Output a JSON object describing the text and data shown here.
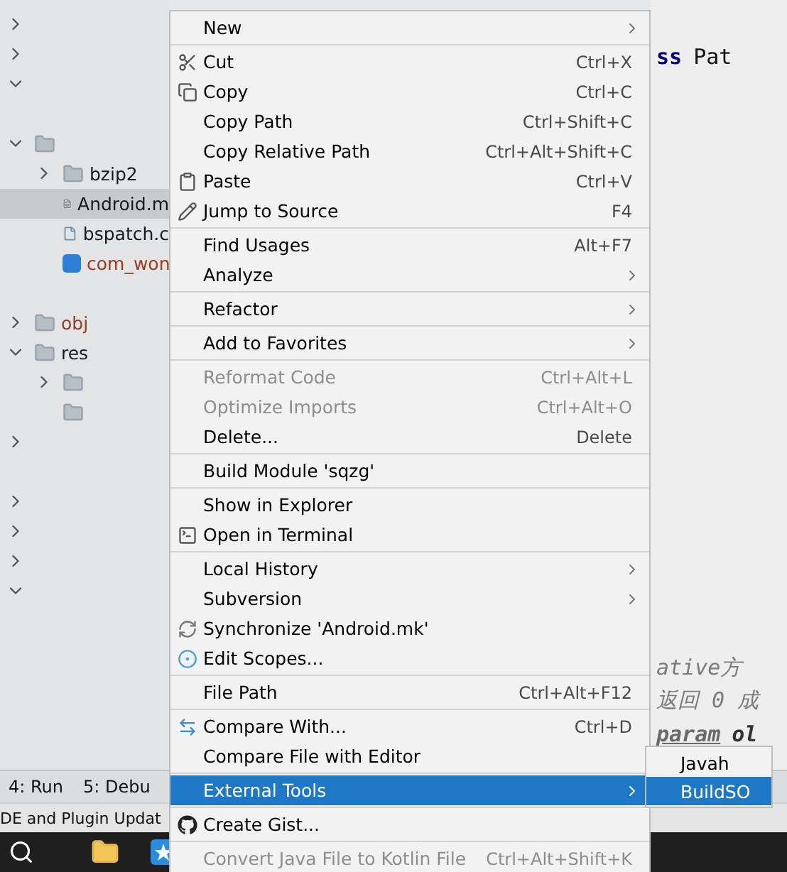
{
  "project_tree": {
    "rows": [
      {
        "kind": "blank",
        "expanded": false
      },
      {
        "kind": "blank",
        "expanded": false
      },
      {
        "kind": "blank",
        "expanded": true
      },
      {
        "kind": "blank"
      },
      {
        "kind": "folder",
        "expanded": true,
        "children": [
          {
            "kind": "folder",
            "expanded": false,
            "label": "bzip2"
          },
          {
            "kind": "file",
            "label": "Android.m",
            "selected": true
          },
          {
            "kind": "cfile",
            "label": "bspatch.c",
            "selected": false
          },
          {
            "kind": "header",
            "label": "com_won",
            "selected": false
          },
          {
            "kind": "blank"
          }
        ]
      },
      {
        "kind": "folder",
        "expanded": false,
        "label": "obj",
        "excluded": true
      },
      {
        "kind": "folder",
        "expanded": true,
        "label": "res",
        "excluded": false,
        "children": [
          {
            "kind": "folder",
            "expanded": false
          },
          {
            "kind": "folder"
          }
        ]
      },
      {
        "kind": "blank",
        "expanded": false
      },
      {
        "kind": "blank"
      },
      {
        "kind": "blank",
        "expanded": false
      },
      {
        "kind": "blank",
        "expanded": false
      },
      {
        "kind": "blank",
        "expanded": false
      },
      {
        "kind": "blank",
        "expanded": true
      }
    ]
  },
  "editor": {
    "top_line": {
      "keyword": "ss",
      "text": "Pat"
    },
    "bottom_lines": [
      {
        "kind": "comment",
        "text": "ative方"
      },
      {
        "kind": "comment",
        "text": "返回 0 成"
      },
      {
        "kind": "doc_tag",
        "tag": "param",
        "text": "ol"
      }
    ]
  },
  "tool_window_bar": [
    "4: Run",
    "5: Debu"
  ],
  "status_bar": "DE and Plugin Updat",
  "context_menu": {
    "groups": [
      {
        "items": [
          {
            "label": "New",
            "submenu": true
          }
        ]
      },
      {
        "items": [
          {
            "label": "Cut",
            "shortcut": "Ctrl+X"
          },
          {
            "label": "Copy",
            "shortcut": "Ctrl+C"
          },
          {
            "label": "Copy Path",
            "shortcut": "Ctrl+Shift+C"
          },
          {
            "label": "Copy Relative Path",
            "shortcut": "Ctrl+Alt+Shift+C"
          },
          {
            "label": "Paste",
            "shortcut": "Ctrl+V"
          },
          {
            "label": "Jump to Source",
            "shortcut": "F4"
          }
        ]
      },
      {
        "items": [
          {
            "label": "Find Usages",
            "shortcut": "Alt+F7"
          },
          {
            "label": "Analyze",
            "submenu": true
          }
        ]
      },
      {
        "items": [
          {
            "label": "Refactor",
            "submenu": true
          }
        ]
      },
      {
        "items": [
          {
            "label": "Add to Favorites",
            "submenu": true
          }
        ]
      },
      {
        "items": [
          {
            "label": "Reformat Code",
            "shortcut": "Ctrl+Alt+L",
            "disabled": true
          },
          {
            "label": "Optimize Imports",
            "shortcut": "Ctrl+Alt+O",
            "disabled": true
          },
          {
            "label": "Delete...",
            "shortcut": "Delete",
            "disabled": false
          }
        ]
      },
      {
        "items": [
          {
            "label": "Build Module 'sqzg'"
          }
        ]
      },
      {
        "items": [
          {
            "label": "Show in Explorer"
          },
          {
            "label": "Open in Terminal"
          }
        ]
      },
      {
        "items": [
          {
            "label": "Local History",
            "submenu": true
          },
          {
            "label": "Subversion",
            "submenu": true
          },
          {
            "label": "Synchronize 'Android.mk'"
          },
          {
            "label": "Edit Scopes..."
          }
        ]
      },
      {
        "items": [
          {
            "label": "File Path",
            "shortcut": "Ctrl+Alt+F12"
          }
        ]
      },
      {
        "items": [
          {
            "label": "Compare With...",
            "shortcut": "Ctrl+D"
          },
          {
            "label": "Compare File with Editor"
          }
        ]
      },
      {
        "items": [
          {
            "label": "External Tools",
            "submenu": true,
            "selected": true
          }
        ]
      },
      {
        "items": [
          {
            "label": "Create Gist..."
          }
        ]
      },
      {
        "items": [
          {
            "label": "Convert Java File to Kotlin File",
            "shortcut": "Ctrl+Alt+Shift+K",
            "disabled": true
          }
        ]
      }
    ]
  },
  "submenu": {
    "items": [
      {
        "label": "Javah",
        "selected": false
      },
      {
        "label": "BuildSO",
        "selected": true
      }
    ]
  }
}
